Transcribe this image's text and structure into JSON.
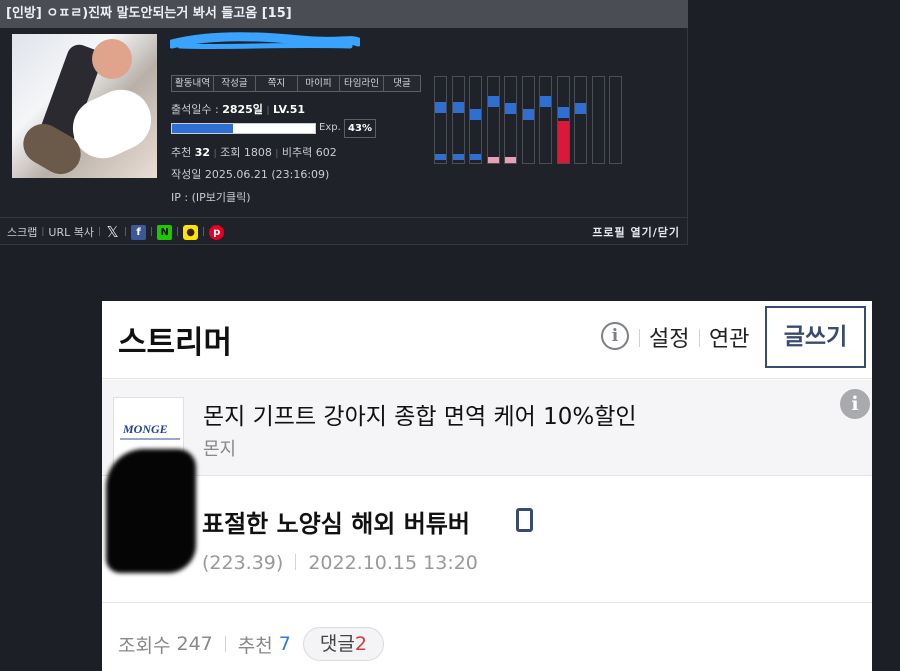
{
  "post_header": {
    "title": "[인방] ㅇㅍㄹ)진짜 말도안되는거 봐서 들고옴 [15]"
  },
  "profile": {
    "tabs": [
      "활동내역",
      "작성글",
      "쪽지",
      "마이피",
      "타임라인",
      "댓글"
    ],
    "attendance_label": "출석일수 :",
    "attendance_value": "2825일",
    "level": "LV.51",
    "exp_label": "Exp.",
    "exp_percent": "43%",
    "exp_fraction": 0.43,
    "recommend_label": "추천",
    "recommend_value": "32",
    "views_label": "조회 1808",
    "nonrec_label": "비추력 602",
    "date_label": "작성일 2025.06.21 (23:16:09)",
    "ip_label": "IP : (IP보기클릭)",
    "activity_columns": [
      {
        "top": 0.28,
        "bottom": 0.92,
        "bottom_color": "#2f6fd1"
      },
      {
        "top": 0.28,
        "bottom": 0.92,
        "bottom_color": "#2f6fd1"
      },
      {
        "top": 0.36,
        "bottom": 0.92,
        "bottom_color": "#2f6fd1"
      },
      {
        "top": 0.22,
        "bottom": 0.96,
        "bottom_color": "#e8a0b4"
      },
      {
        "top": 0.3,
        "bottom": 0.96,
        "bottom_color": "#e8a0b4"
      },
      {
        "top": 0.36,
        "bottom": null,
        "bottom_color": null
      },
      {
        "top": 0.22,
        "bottom": null,
        "bottom_color": null
      },
      {
        "top": 0.34,
        "bottom": 0.5,
        "bottom_color": "#d9183a"
      },
      {
        "top": 0.3,
        "bottom": null,
        "bottom_color": null
      },
      {
        "top": null,
        "bottom": null,
        "bottom_color": null
      },
      {
        "top": null,
        "bottom": null,
        "bottom_color": null
      }
    ]
  },
  "share_bar": {
    "scrap": "스크랩",
    "url_copy": "URL 복사",
    "profile_toggle": "프로필 열기/닫기",
    "icons": [
      "x-icon",
      "facebook-icon",
      "naver-icon",
      "kakao-icon",
      "pinterest-icon"
    ]
  },
  "mobile": {
    "board_title": "스트리머",
    "info_icon": "info-icon",
    "settings": "설정",
    "related": "연관",
    "write_button": "글쓰기",
    "ad": {
      "logo_text": "MONGE",
      "title": "몬지 기프트 강아지 종합 면역 케어 10%할인",
      "brand": "몬지"
    },
    "post": {
      "title": "표절한 노양심 해외 버튜버",
      "author_visible": "(223.39)",
      "datetime": "2022.10.15 13:20"
    },
    "stats": {
      "views_label": "조회수",
      "views": "247",
      "recommend_label": "추천",
      "recommend": "7",
      "reply_label": "댓글",
      "reply_count": "2"
    }
  }
}
